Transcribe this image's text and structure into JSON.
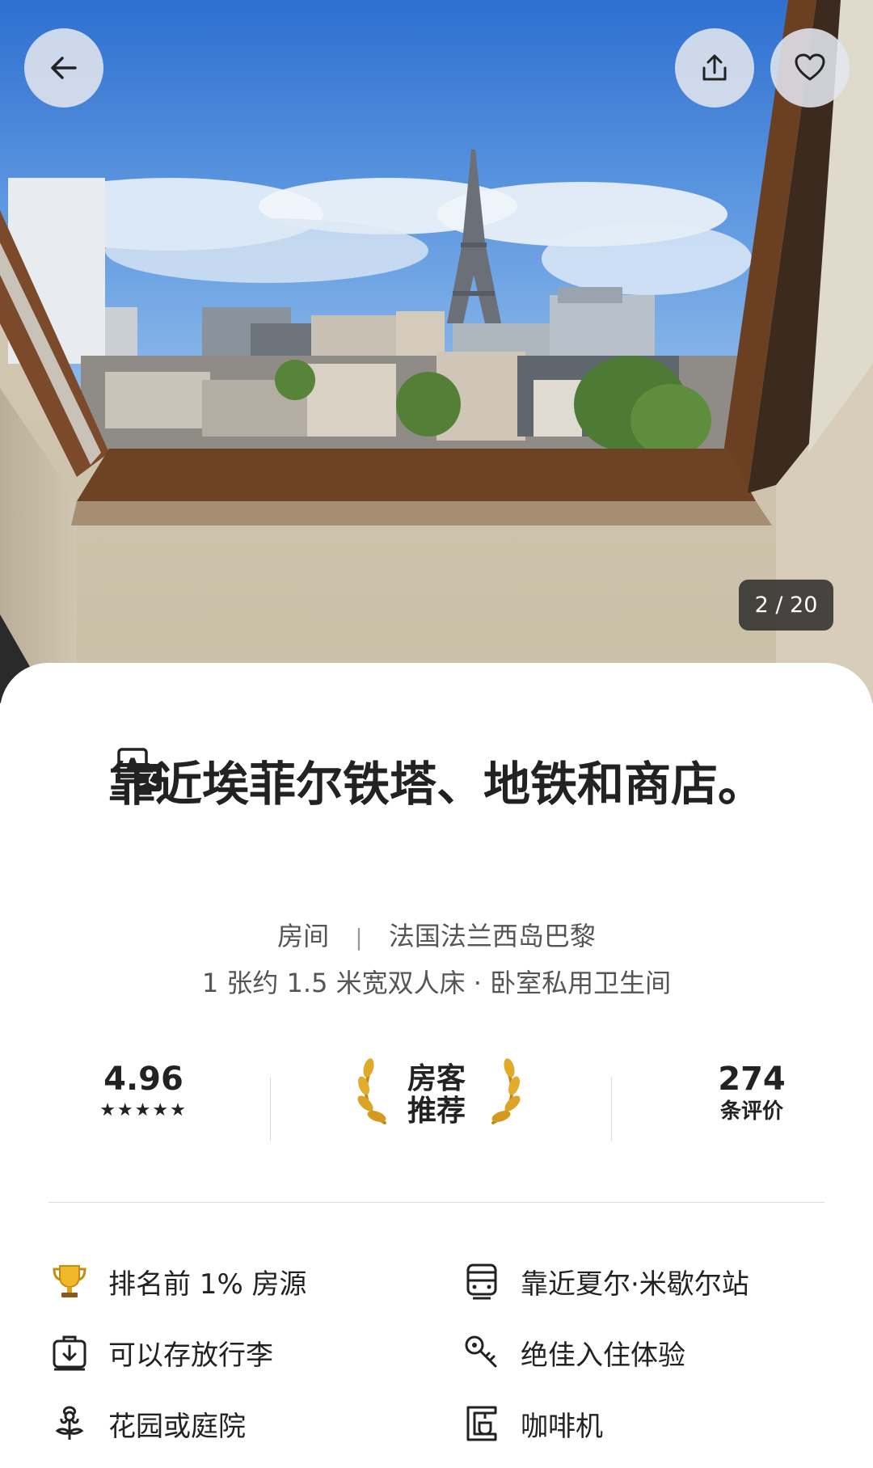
{
  "gallery": {
    "counter": "2 / 20",
    "image_description_icon": "photo-eiffel-view-icon"
  },
  "buttons": {
    "back_icon": "arrow-left-icon",
    "share_icon": "share-icon",
    "favorite_icon": "heart-icon"
  },
  "listing": {
    "title": "靠近埃菲尔铁塔、地铁和商店。",
    "title_icon": "translate-icon",
    "room_type": "房间",
    "location": "法国法兰西岛巴黎",
    "details": "1 张约 1.5 米宽双人床 · 卧室私用卫生间"
  },
  "stats": {
    "rating": "4.96",
    "stars": "★★★★★",
    "guest_favorite_line1": "房客",
    "guest_favorite_line2": "推荐",
    "reviews_count": "274",
    "reviews_label": "条评价"
  },
  "features": [
    {
      "label": "排名前 1% 房源",
      "icon": "trophy-icon"
    },
    {
      "label": "靠近夏尔·米歇尔站",
      "icon": "train-icon"
    },
    {
      "label": "可以存放行李",
      "icon": "luggage-icon"
    },
    {
      "label": "绝佳入住体验",
      "icon": "key-icon"
    },
    {
      "label": "花园或庭院",
      "icon": "flower-icon"
    },
    {
      "label": "咖啡机",
      "icon": "coffee-machine-icon"
    }
  ],
  "colors": {
    "text": "#222222",
    "secondary": "#555555",
    "divider": "#dddddd",
    "gold": "#d9a21b"
  }
}
